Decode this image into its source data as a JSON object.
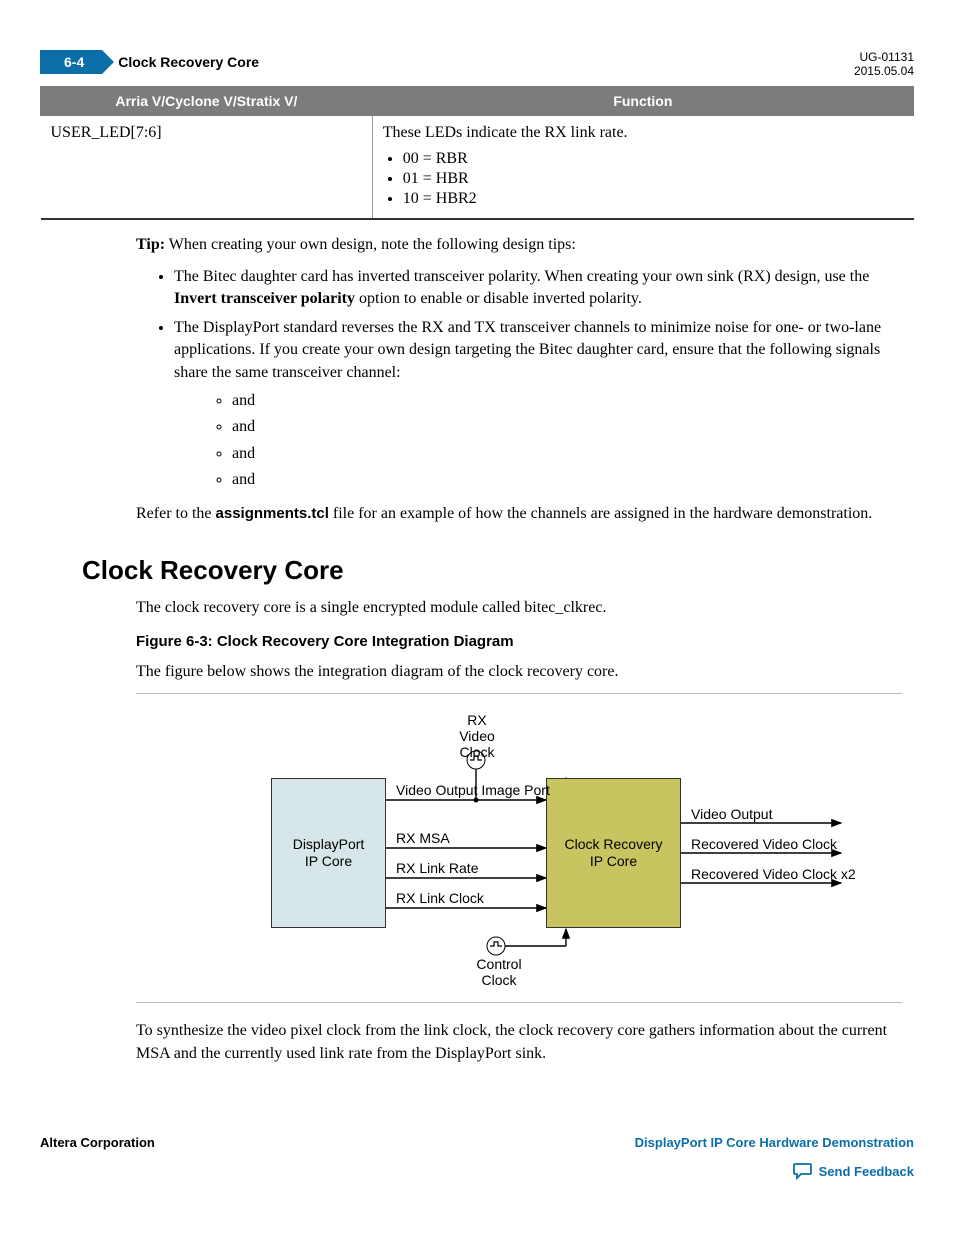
{
  "header": {
    "page_num": "6-4",
    "title": "Clock Recovery Core",
    "doc_id": "UG-01131",
    "date": "2015.05.04"
  },
  "table": {
    "head_col1": "Arria V/Cyclone V/Stratix V/",
    "head_col2": "Function",
    "row_col1": "USER_LED[7:6]",
    "row_col2_intro": "These LEDs indicate the RX link rate.",
    "row_col2_items": {
      "a": "00 = RBR",
      "b": "01 = HBR",
      "c": "10 = HBR2"
    }
  },
  "tip": {
    "label": "Tip:",
    "text": "When creating your own design, note the following design tips:"
  },
  "bullets": {
    "b1_pre": "The Bitec daughter card has inverted transceiver polarity. When creating your own sink (RX) design, use the ",
    "b1_bold": "Invert transceiver polarity",
    "b1_post": " option to enable or disable inverted polarity.",
    "b2": "The DisplayPort standard reverses the RX and TX transceiver channels to minimize noise for one- or two-lane applications. If you create your own design targeting the Bitec daughter card, ensure that the following signals share the same transceiver channel:",
    "sub_and": "and"
  },
  "refer": {
    "pre": "Refer to the ",
    "bold": "assignments.tcl",
    "post": " file for an example of how the channels are assigned in the hardware demonstration."
  },
  "section": {
    "heading": "Clock Recovery Core",
    "intro": "The clock recovery core is a single encrypted module called bitec_clkrec.",
    "fig_cap": "Figure 6-3: Clock Recovery Core Integration Diagram",
    "fig_intro": "The figure below shows the integration diagram of the clock recovery core.",
    "closing": "To synthesize the video pixel clock from the link clock, the clock recovery core gathers information about the current MSA and the currently used link rate from the DisplayPort sink."
  },
  "diagram": {
    "box_dp": "DisplayPort\nIP Core",
    "box_cr": "Clock Recovery\nIP Core",
    "rx_video_clock": "RX Video\nClock",
    "video_output_image_port": "Video Output Image Port",
    "rx_msa": "RX MSA",
    "rx_link_rate": "RX Link Rate",
    "rx_link_clock": "RX Link Clock",
    "control_clock": "Control\nClock",
    "video_output": "Video Output",
    "recovered_video_clock": "Recovered Video Clock",
    "recovered_video_clock_x2": "Recovered Video Clock x2"
  },
  "footer": {
    "left": "Altera Corporation",
    "right_link": "DisplayPort IP Core Hardware Demonstration",
    "feedback": "Send Feedback"
  }
}
